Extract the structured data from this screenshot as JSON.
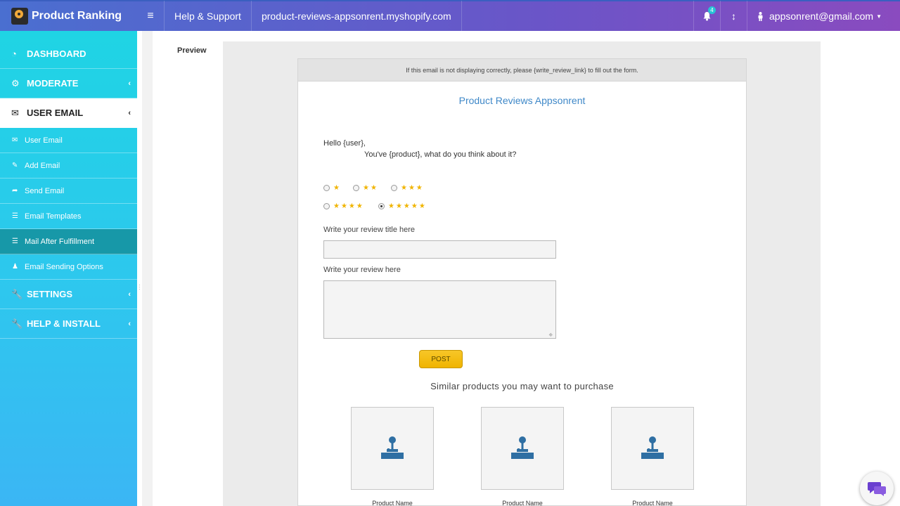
{
  "app": {
    "title": "Product Ranking"
  },
  "header": {
    "help_label": "Help & Support",
    "store_url": "product-reviews-appsonrent.myshopify.com",
    "notification_count": "4",
    "user_email": "appsonrent@gmail.com"
  },
  "sidebar": {
    "dashboard": "DASHBOARD",
    "moderate": "MODERATE",
    "user_email": "USER EMAIL",
    "sub_items": [
      {
        "label": "User Email",
        "icon": "envelope-icon"
      },
      {
        "label": "Add Email",
        "icon": "edit-icon"
      },
      {
        "label": "Send Email",
        "icon": "share-icon"
      },
      {
        "label": "Email Templates",
        "icon": "list-icon"
      },
      {
        "label": "Mail After Fulfillment",
        "icon": "list-icon"
      },
      {
        "label": "Email Sending Options",
        "icon": "user-icon"
      }
    ],
    "settings": "SETTINGS",
    "help_install": "HELP & INSTALL"
  },
  "main": {
    "preview_label": "Preview",
    "email": {
      "notice": "If this email is not displaying correctly, please {write_review_link} to fill out the form.",
      "store_name": "Product Reviews Appsonrent",
      "greeting": "Hello {user},",
      "prompt": "You've {product}, what do you think about it?",
      "ratings": [
        {
          "stars": "★",
          "value": 1,
          "checked": false
        },
        {
          "stars": "★★",
          "value": 2,
          "checked": false
        },
        {
          "stars": "★★★",
          "value": 3,
          "checked": false
        },
        {
          "stars": "★★★★",
          "value": 4,
          "checked": false
        },
        {
          "stars": "★★★★★",
          "value": 5,
          "checked": true
        }
      ],
      "title_label": "Write your review title here",
      "review_label": "Write your review here",
      "post_label": "POST",
      "similar_heading": "Similar products you may want to purchase",
      "products": [
        {
          "name": "Product Name"
        },
        {
          "name": "Product Name"
        },
        {
          "name": "Product Name"
        }
      ]
    }
  },
  "colors": {
    "accent": "#3f88c8",
    "star": "#f0b400",
    "sidebar_active": "#1798a8"
  }
}
